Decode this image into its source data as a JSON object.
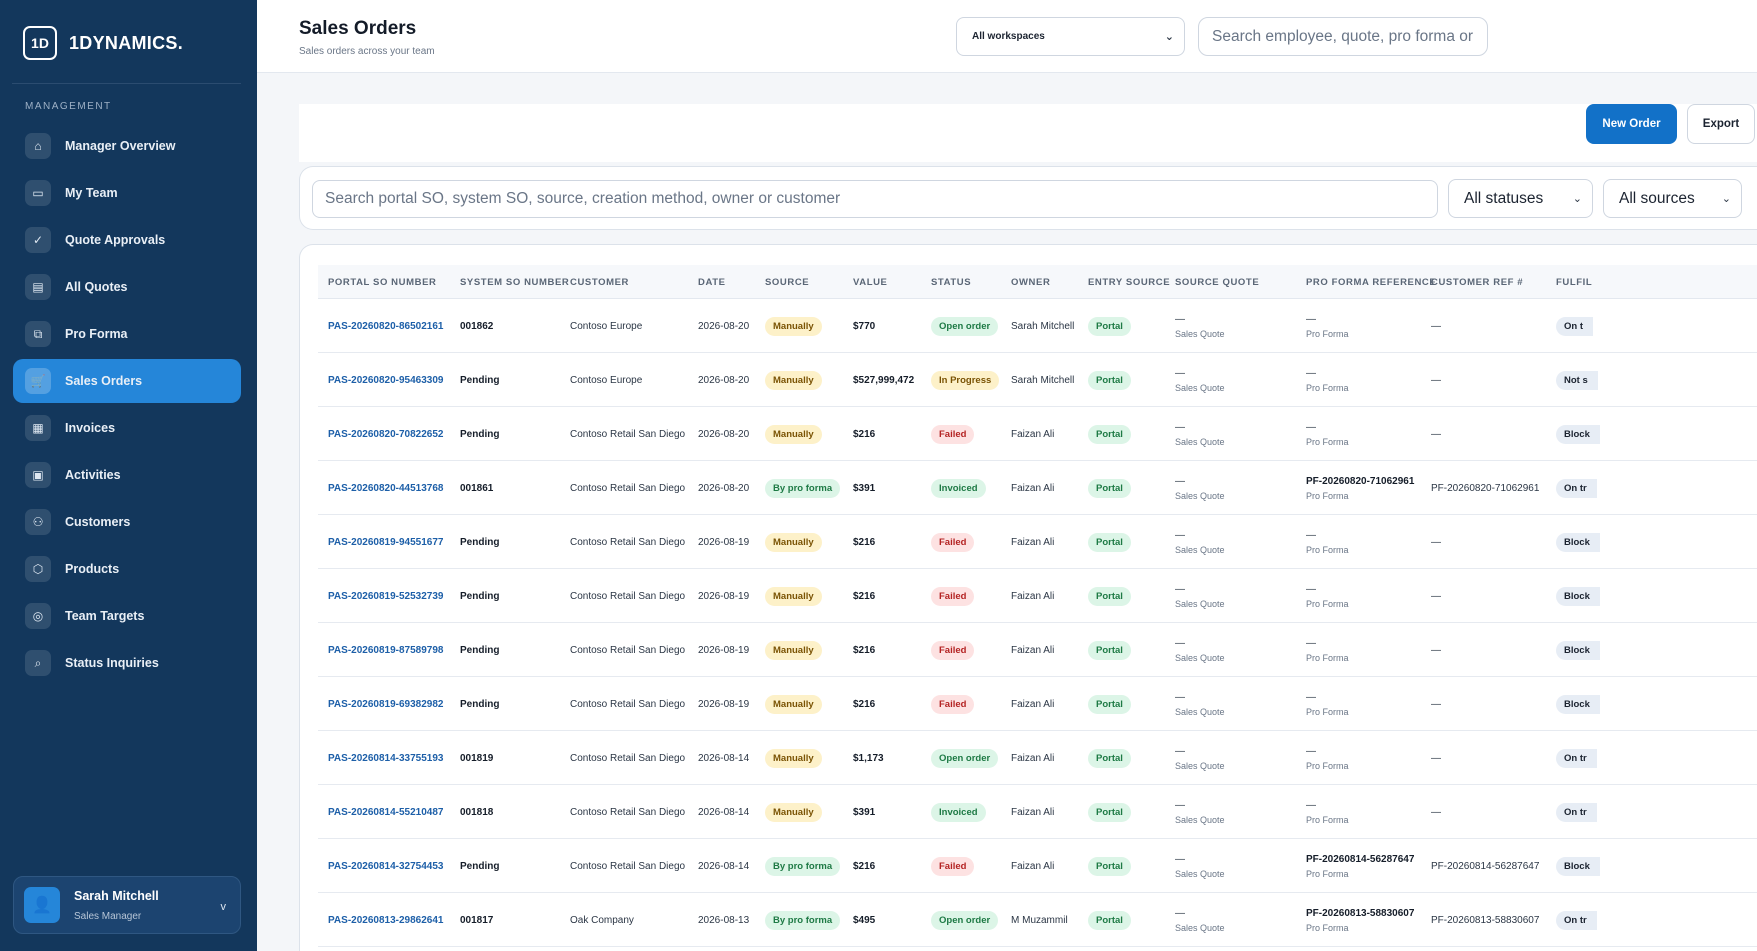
{
  "brand": {
    "badge": "1D",
    "name": "1DYNAMICS."
  },
  "sidebar": {
    "section": "MANAGEMENT",
    "items": [
      {
        "label": "Manager Overview",
        "icon": "⌂"
      },
      {
        "label": "My Team",
        "icon": "▭"
      },
      {
        "label": "Quote Approvals",
        "icon": "✓"
      },
      {
        "label": "All Quotes",
        "icon": "▤"
      },
      {
        "label": "Pro Forma",
        "icon": "⧉"
      },
      {
        "label": "Sales Orders",
        "icon": "🛒"
      },
      {
        "label": "Invoices",
        "icon": "▦"
      },
      {
        "label": "Activities",
        "icon": "▣"
      },
      {
        "label": "Customers",
        "icon": "⚇"
      },
      {
        "label": "Products",
        "icon": "⬡"
      },
      {
        "label": "Team Targets",
        "icon": "◎"
      },
      {
        "label": "Status Inquiries",
        "icon": "⌕"
      }
    ],
    "active_index": 5,
    "user": {
      "name": "Sarah Mitchell",
      "role": "Sales Manager",
      "avatar_icon": "👤",
      "chevron": "v"
    }
  },
  "header": {
    "title": "Sales Orders",
    "subtitle": "Sales orders across your team",
    "workspace_select": "All workspaces",
    "search_placeholder": "Search employee, quote, pro forma or"
  },
  "toolbar": {
    "new_order": "New Order",
    "export": "Export"
  },
  "filters": {
    "search_placeholder": "Search portal SO, system SO, source, creation method, owner or customer",
    "status": "All statuses",
    "source": "All sources"
  },
  "table": {
    "columns": [
      "PORTAL SO NUMBER",
      "SYSTEM SO NUMBER",
      "CUSTOMER",
      "DATE",
      "SOURCE",
      "VALUE",
      "STATUS",
      "OWNER",
      "ENTRY SOURCE",
      "SOURCE QUOTE",
      "PRO FORMA REFERENCE",
      "CUSTOMER REF #",
      "FULFIL"
    ],
    "source_quote_sub": "Sales Quote",
    "proforma_sub": "Pro Forma",
    "rows": [
      {
        "portal": "PAS-20260820-86502161",
        "system": "001862",
        "customer": "Contoso Europe",
        "date": "2026-08-20",
        "source": "Manually",
        "value": "$770",
        "status": "Open order",
        "owner": "Sarah Mitchell",
        "entry": "Portal",
        "quote": "—",
        "pf": "—",
        "custref": "—",
        "fulfil": "On t"
      },
      {
        "portal": "PAS-20260820-95463309",
        "system": "Pending",
        "customer": "Contoso Europe",
        "date": "2026-08-20",
        "source": "Manually",
        "value": "$527,999,472",
        "status": "In Progress",
        "owner": "Sarah Mitchell",
        "entry": "Portal",
        "quote": "—",
        "pf": "—",
        "custref": "—",
        "fulfil": "Not s"
      },
      {
        "portal": "PAS-20260820-70822652",
        "system": "Pending",
        "customer": "Contoso Retail San Diego",
        "date": "2026-08-20",
        "source": "Manually",
        "value": "$216",
        "status": "Failed",
        "owner": "Faizan Ali",
        "entry": "Portal",
        "quote": "—",
        "pf": "—",
        "custref": "—",
        "fulfil": "Block"
      },
      {
        "portal": "PAS-20260820-44513768",
        "system": "001861",
        "customer": "Contoso Retail San Diego",
        "date": "2026-08-20",
        "source": "By pro forma",
        "value": "$391",
        "status": "Invoiced",
        "owner": "Faizan Ali",
        "entry": "Portal",
        "quote": "—",
        "pf": "PF-20260820-71062961",
        "custref": "PF-20260820-71062961",
        "fulfil": "On tr"
      },
      {
        "portal": "PAS-20260819-94551677",
        "system": "Pending",
        "customer": "Contoso Retail San Diego",
        "date": "2026-08-19",
        "source": "Manually",
        "value": "$216",
        "status": "Failed",
        "owner": "Faizan Ali",
        "entry": "Portal",
        "quote": "—",
        "pf": "—",
        "custref": "—",
        "fulfil": "Block"
      },
      {
        "portal": "PAS-20260819-52532739",
        "system": "Pending",
        "customer": "Contoso Retail San Diego",
        "date": "2026-08-19",
        "source": "Manually",
        "value": "$216",
        "status": "Failed",
        "owner": "Faizan Ali",
        "entry": "Portal",
        "quote": "—",
        "pf": "—",
        "custref": "—",
        "fulfil": "Block"
      },
      {
        "portal": "PAS-20260819-87589798",
        "system": "Pending",
        "customer": "Contoso Retail San Diego",
        "date": "2026-08-19",
        "source": "Manually",
        "value": "$216",
        "status": "Failed",
        "owner": "Faizan Ali",
        "entry": "Portal",
        "quote": "—",
        "pf": "—",
        "custref": "—",
        "fulfil": "Block"
      },
      {
        "portal": "PAS-20260819-69382982",
        "system": "Pending",
        "customer": "Contoso Retail San Diego",
        "date": "2026-08-19",
        "source": "Manually",
        "value": "$216",
        "status": "Failed",
        "owner": "Faizan Ali",
        "entry": "Portal",
        "quote": "—",
        "pf": "—",
        "custref": "—",
        "fulfil": "Block"
      },
      {
        "portal": "PAS-20260814-33755193",
        "system": "001819",
        "customer": "Contoso Retail San Diego",
        "date": "2026-08-14",
        "source": "Manually",
        "value": "$1,173",
        "status": "Open order",
        "owner": "Faizan Ali",
        "entry": "Portal",
        "quote": "—",
        "pf": "—",
        "custref": "—",
        "fulfil": "On tr"
      },
      {
        "portal": "PAS-20260814-55210487",
        "system": "001818",
        "customer": "Contoso Retail San Diego",
        "date": "2026-08-14",
        "source": "Manually",
        "value": "$391",
        "status": "Invoiced",
        "owner": "Faizan Ali",
        "entry": "Portal",
        "quote": "—",
        "pf": "—",
        "custref": "—",
        "fulfil": "On tr"
      },
      {
        "portal": "PAS-20260814-32754453",
        "system": "Pending",
        "customer": "Contoso Retail San Diego",
        "date": "2026-08-14",
        "source": "By pro forma",
        "value": "$216",
        "status": "Failed",
        "owner": "Faizan Ali",
        "entry": "Portal",
        "quote": "—",
        "pf": "PF-20260814-56287647",
        "custref": "PF-20260814-56287647",
        "fulfil": "Block"
      },
      {
        "portal": "PAS-20260813-29862641",
        "system": "001817",
        "customer": "Oak Company",
        "date": "2026-08-13",
        "source": "By pro forma",
        "value": "$495",
        "status": "Open order",
        "owner": "M Muzammil",
        "entry": "Portal",
        "quote": "—",
        "pf": "PF-20260813-58830607",
        "custref": "PF-20260813-58830607",
        "fulfil": "On tr"
      }
    ]
  }
}
